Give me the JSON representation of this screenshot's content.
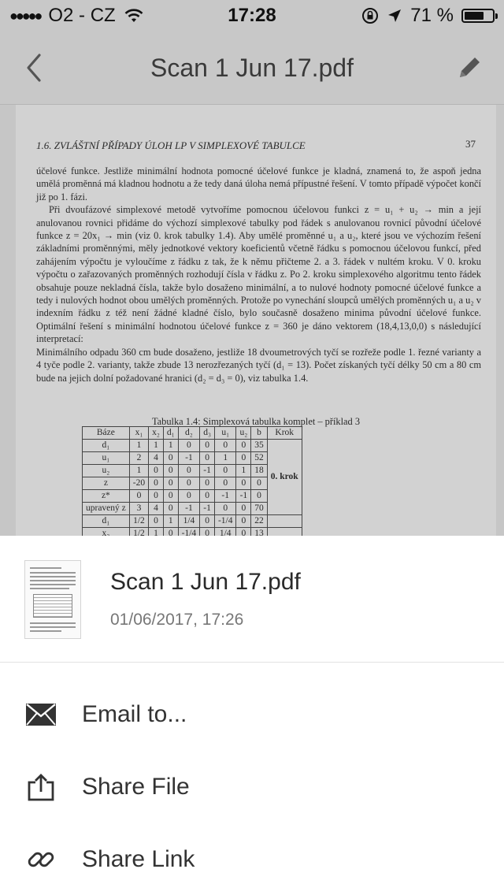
{
  "status_bar": {
    "carrier": "O2 - CZ",
    "time": "17:28",
    "battery": "71 %",
    "battery_level": 0.71
  },
  "nav": {
    "title": "Scan 1 Jun 17.pdf",
    "back_icon": "chevron-left-icon",
    "edit_icon": "pencil-icon"
  },
  "document": {
    "header": "1.6.  ZVLÁŠTNÍ PŘÍPADY ÚLOH LP V SIMPLEXOVÉ TABULCE",
    "page_number": "37",
    "paragraph1": "účelové funkce. Jestliže minimální hodnota pomocné účelové funkce je kladná, znamená to, že aspoň jedna umělá proměnná má kladnou hodnotu a že tedy daná úloha nemá přípustné řešení. V tomto případě výpočet končí již po 1. fázi.",
    "paragraph2": "Při dvoufázové simplexové metodě vytvoříme pomocnou účelovou funkci z = u₁ + u₂ → min a její anulovanou rovnici přidáme do výchozí simplexové tabulky pod řádek s anulovanou rovnicí původní účelové funkce z = 20x₁ → min (viz 0. krok tabulky 1.4). Aby umělé proměnné u₁ a u₂, které jsou ve výchozím řešení základními proměnnými, měly jednotkové vektory koeficientů včetně řádku s pomocnou účelovou funkcí, před zahájením výpočtu je vyloučíme z řádku z tak, že k němu přičteme 2. a 3. řádek v nultém kroku. V 0. kroku výpočtu o zařazovaných proměnných rozhodují čísla v řádku z. Po 2. kroku simplexového algoritmu tento řádek obsahuje pouze nekladná čísla, takže bylo dosaženo minimální, a to nulové hodnoty pomocné účelové funkce a tedy i nulových hodnot obou umělých proměnných. Protože po vynechání sloupců umělých proměnných u₁ a u₂ v indexním řádku z též není žádné kladné číslo, bylo současně dosaženo minima původní účelové funkce. Optimální řešení s minimální hodnotou účelové funkce z = 360 je dáno vektorem (18,4,13,0,0) s následující interpretací:",
    "paragraph3": "Minimálního odpadu 360 cm bude dosaženo, jestliže 18 dvoumetrových tyčí se rozřeže podle 1. řezné varianty a 4 tyče podle 2. varianty, takže zbude 13 nerozřezaných tyčí (d₁ = 13). Počet získaných tyčí délky 50 cm a 80 cm bude na jejich dolní požadované hranici (d₂ = d₃ = 0), viz tabulka 1.4.",
    "table_caption": "Tabulka 1.4: Simplexová tabulka komplet – příklad 3",
    "table_headers": [
      "Báze",
      "x₁",
      "x₂",
      "d₁",
      "d₂",
      "d₃",
      "u₁",
      "u₂",
      "b",
      "Krok"
    ],
    "table_rows": [
      [
        "d₁",
        "1",
        "1",
        "1",
        "0",
        "0",
        "0",
        "0",
        "35"
      ],
      [
        "u₁",
        "2",
        "4",
        "0",
        "-1",
        "0",
        "1",
        "0",
        "52"
      ],
      [
        "u₂",
        "1",
        "0",
        "0",
        "0",
        "-1",
        "0",
        "1",
        "18"
      ],
      [
        "z",
        "-20",
        "0",
        "0",
        "0",
        "0",
        "0",
        "0",
        "0"
      ],
      [
        "z*",
        "0",
        "0",
        "0",
        "0",
        "0",
        "-1",
        "-1",
        "0"
      ],
      [
        "upravený z",
        "3",
        "4",
        "0",
        "-1",
        "-1",
        "0",
        "0",
        "70"
      ],
      [
        "d₁",
        "1/2",
        "0",
        "1",
        "1/4",
        "0",
        "-1/4",
        "0",
        "22"
      ],
      [
        "x₂",
        "1/2",
        "1",
        "0",
        "-1/4",
        "0",
        "1/4",
        "0",
        "13"
      ]
    ],
    "step_label": "0. krok"
  },
  "sheet": {
    "file_name": "Scan 1 Jun 17.pdf",
    "file_date": "01/06/2017, 17:26",
    "actions": [
      {
        "label": "Email to...",
        "icon": "envelope-icon"
      },
      {
        "label": "Share File",
        "icon": "share-upload-icon"
      },
      {
        "label": "Share Link",
        "icon": "link-icon"
      }
    ]
  }
}
